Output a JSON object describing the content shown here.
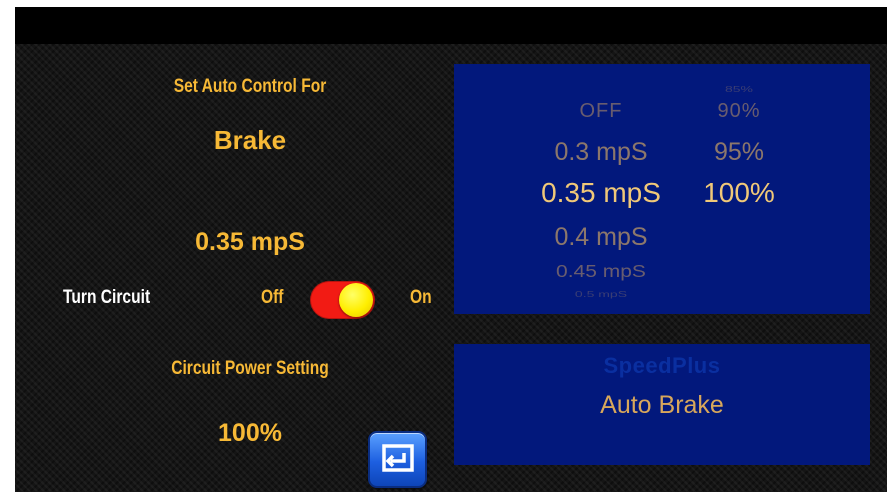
{
  "left_panel": {
    "heading": "Set Auto Control For",
    "control_name": "Brake",
    "speed_value": "0.35 mpS",
    "turn_circuit_label": "Turn Circuit",
    "off_label": "Off",
    "on_label": "On",
    "circuit_on": true,
    "power_heading": "Circuit Power Setting",
    "power_value": "100%"
  },
  "picker": {
    "speed_column": [
      "OFF",
      "0.3 mpS",
      "0.35 mpS",
      "0.4 mpS",
      "0.45 mpS",
      "0.5 mpS"
    ],
    "speed_selected": "0.35 mpS",
    "power_column": [
      "85%",
      "90%",
      "95%",
      "100%"
    ],
    "power_selected": "100%"
  },
  "info_panel": {
    "app_name": "SpeedPlus",
    "mode": "Auto Brake"
  },
  "icons": {
    "back_button": "return-arrow-icon"
  },
  "colors": {
    "accent": "#f7b936",
    "panel_bg": "#02187c",
    "toggle_track": "#f21b14",
    "toggle_knob": "#ffee00",
    "picker_selected": "#f0c878",
    "picker_text": "#c9a064"
  }
}
